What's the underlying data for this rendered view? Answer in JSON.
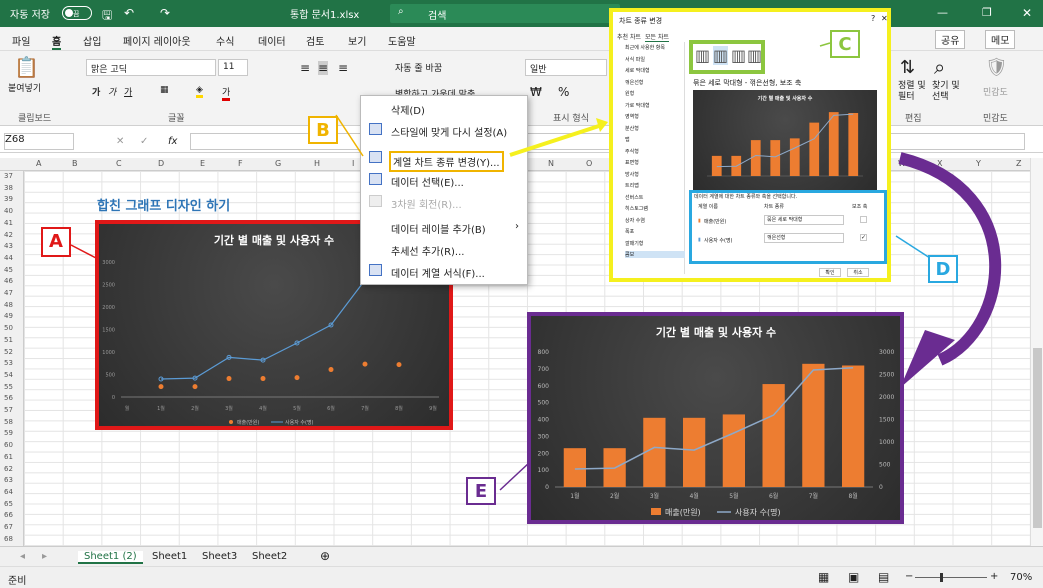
{
  "titlebar": {
    "autosave": "자동 저장",
    "toggle": "끔",
    "doc_title": "통합 문서1.xlsx",
    "search_placeholder": "검색"
  },
  "menu": [
    "파일",
    "홈",
    "삽입",
    "페이지 레이아웃",
    "수식",
    "데이터",
    "검토",
    "보기",
    "도움말"
  ],
  "menu_right": {
    "share": "공유",
    "memo": "메모"
  },
  "ribbon": {
    "paste": "붙여넣기",
    "clipboard": "클립보드",
    "font_name": "맑은 고딕",
    "font_size": "11",
    "font_group": "글꼴",
    "wrap": "자동 줄 바꿈",
    "merge": "병합하고 가운데 맞춤",
    "number_format": "일반",
    "display_format": "표시 형식",
    "sort_filter": "정렬 및\n필터",
    "find_select": "찾기 및\n선택",
    "edit": "편집",
    "sensitivity": "민감도"
  },
  "formula_bar": {
    "name_box": "Z68",
    "fx": "fx"
  },
  "columns": [
    "A",
    "B",
    "C",
    "D",
    "E",
    "F",
    "G",
    "H",
    "I",
    "J",
    "K",
    "L",
    "M",
    "N",
    "O",
    "P",
    "Q",
    "R",
    "S",
    "T",
    "U",
    "V",
    "W",
    "X",
    "Y",
    "Z"
  ],
  "rows": [
    "37",
    "38",
    "39",
    "40",
    "41",
    "42",
    "43",
    "44",
    "45",
    "46",
    "47",
    "48",
    "49",
    "50",
    "51",
    "52",
    "53",
    "54",
    "55",
    "56",
    "57",
    "58",
    "59",
    "60",
    "61",
    "62",
    "63",
    "64",
    "65",
    "66",
    "67",
    "68"
  ],
  "heading": "합친 그래프 디자인 하기",
  "context_menu": [
    "삭제(D)",
    "스타일에 맞게 다시 설정(A)",
    "계열 차트 종류 변경(Y)...",
    "데이터 선택(E)...",
    "3차원 회전(R)...",
    "데이터 레이블 추가(B)",
    "추세선 추가(R)...",
    "데이터 계열 서식(F)..."
  ],
  "dialog": {
    "title": "차트 종류 변경",
    "tab_recommended": "추천 차트",
    "tab_all": "모든 차트",
    "categories": [
      "최근에 사용한 항목",
      "서식 파일",
      "세로 막대형",
      "꺾은선형",
      "원형",
      "가로 막대형",
      "영역형",
      "분산형",
      "맵",
      "주식형",
      "표면형",
      "방사형",
      "트리맵",
      "선버스트",
      "히스토그램",
      "상자 수염",
      "폭포",
      "깔때기형",
      "콤보"
    ],
    "subtitle": "묶은 세로 막대형 - 꺾은선형, 보조 축",
    "prompt": "데이터 계열에 대한 차트 종류와 축을 선택합니다.",
    "col_name": "계열 이름",
    "col_type": "차트 종류",
    "col_axis": "보조 축",
    "series1": "매출(만원)",
    "series1_type": "묶은 세로 막대형",
    "series2": "사용자 수(명)",
    "series2_type": "꺾은선형",
    "ok": "확인",
    "cancel": "취소"
  },
  "labels": {
    "a": "A",
    "b": "B",
    "c": "C",
    "d": "D",
    "e": "E"
  },
  "sheets": [
    "Sheet1 (2)",
    "Sheet1",
    "Sheet3",
    "Sheet2"
  ],
  "status": {
    "ready": "준비",
    "zoom": "70%"
  },
  "colors": {
    "excel_green": "#217346",
    "bar": "#ed7d31",
    "line": "#5b9bd5",
    "red": "#e01818",
    "yellow": "#f5f01e",
    "green": "#8cc63f",
    "blue": "#29a8e0",
    "purple": "#6a2c91"
  },
  "chart_data": [
    {
      "type": "scatter",
      "title": "기간 별 매출 및 사용자 수",
      "categories": [
        "월",
        "1월",
        "2월",
        "3월",
        "4월",
        "5월",
        "6월",
        "7월",
        "8월",
        "9월"
      ],
      "yticks": [
        "0",
        "500",
        "1000",
        "1500",
        "2000",
        "2500",
        "3000"
      ],
      "series": [
        {
          "name": "매출(만원)",
          "values": [
            null,
            230,
            230,
            410,
            410,
            430,
            610,
            730,
            720,
            null
          ]
        },
        {
          "name": "사용자 수(명)",
          "values": [
            null,
            400,
            420,
            880,
            820,
            1200,
            1600,
            2600,
            3300,
            null
          ]
        }
      ]
    },
    {
      "type": "bar",
      "title": "기간 별 매출 및 사용자 수",
      "categories": [
        "1월",
        "2월",
        "3월",
        "4월",
        "5월",
        "6월",
        "7월",
        "8월"
      ],
      "y1ticks": [
        "0",
        "100",
        "200",
        "300",
        "400",
        "500",
        "600",
        "700",
        "800"
      ],
      "y2ticks": [
        "0",
        "500",
        "1000",
        "1500",
        "2000",
        "2500",
        "3000"
      ],
      "y1lim": [
        0,
        800
      ],
      "y2lim": [
        0,
        3000
      ],
      "series": [
        {
          "name": "매출(만원)",
          "type": "bar",
          "values": [
            230,
            230,
            410,
            410,
            430,
            610,
            730,
            720
          ]
        },
        {
          "name": "사용자 수(명)",
          "type": "line",
          "axis": "secondary",
          "values": [
            400,
            420,
            880,
            820,
            1200,
            1600,
            2600,
            2650
          ]
        }
      ]
    }
  ]
}
